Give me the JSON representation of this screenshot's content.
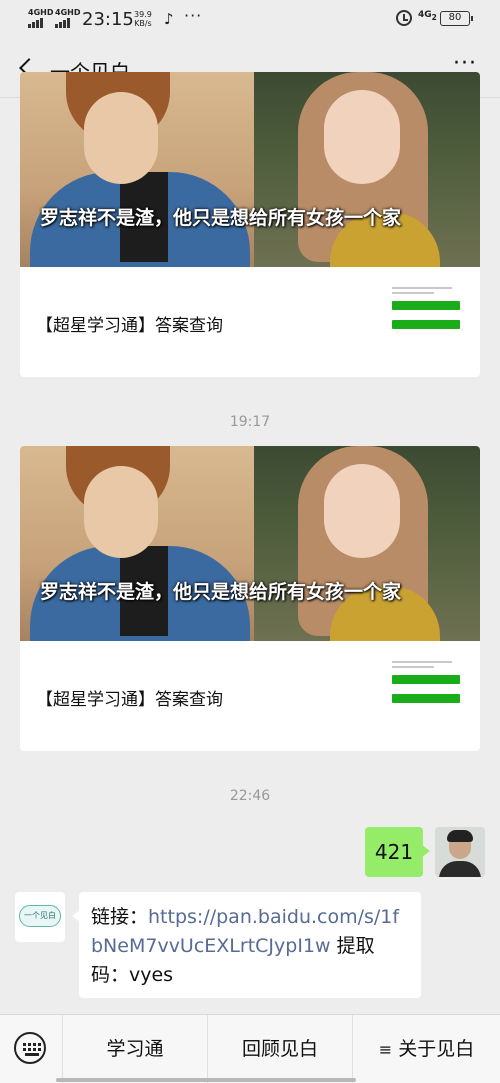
{
  "status_bar": {
    "sim1": "4GHD",
    "sim2": "4GHD",
    "time": "23:15",
    "speed_value": "39.9",
    "speed_unit": "KB/s",
    "app_icon": "tiktok-icon",
    "more": "···",
    "alarm_icon": "alarm-icon",
    "network": "4G",
    "network_sub": "2",
    "battery": "80"
  },
  "nav": {
    "back_icon": "chevron-left-icon",
    "title": "一个见白",
    "more_label": "···"
  },
  "messages": [
    {
      "type": "article",
      "cover_caption": "罗志祥不是渣，他只是想给所有女孩一个家",
      "title": "【超星学习通】答案查询"
    },
    {
      "type": "timestamp",
      "text": "19:17"
    },
    {
      "type": "article",
      "cover_caption": "罗志祥不是渣，他只是想给所有女孩一个家",
      "title": "【超星学习通】答案查询"
    },
    {
      "type": "timestamp",
      "text": "22:46"
    },
    {
      "type": "text_sent",
      "text": "421"
    },
    {
      "type": "text_received",
      "prefix": "链接：",
      "link": "https://pan.baidu.com/s/1fbNeM7vvUcEXLrtCJypI1w",
      "suffix": " 提取码：vyes"
    }
  ],
  "bottom_menu": {
    "keyboard_icon": "keyboard-icon",
    "items": [
      {
        "label": "学习通"
      },
      {
        "label": "回顾见白"
      },
      {
        "label": "关于见白",
        "icon": "menu-lines-icon"
      }
    ]
  },
  "colors": {
    "background": "#ededed",
    "sent_bubble": "#95ec69",
    "link": "#576b95",
    "mini_button": "#1aad19"
  }
}
